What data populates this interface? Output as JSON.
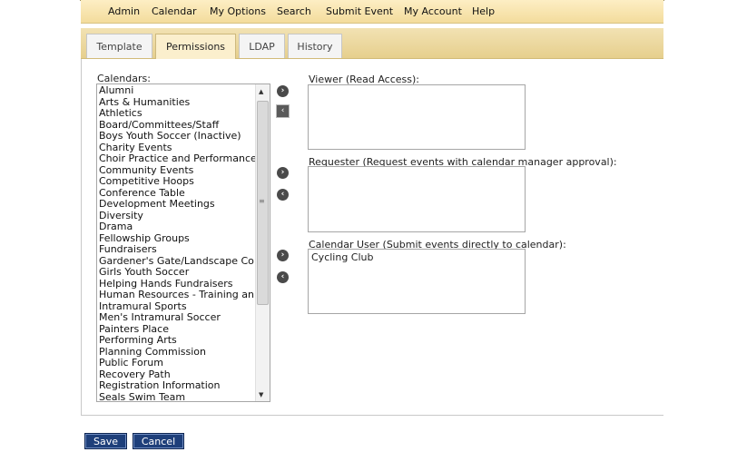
{
  "menu": [
    "Admin",
    "Calendar",
    "My Options",
    "Search",
    "Submit Event",
    "My Account",
    "Help"
  ],
  "tabs": [
    {
      "label": "Template",
      "active": false
    },
    {
      "label": "Permissions",
      "active": true
    },
    {
      "label": "LDAP",
      "active": false
    },
    {
      "label": "History",
      "active": false
    }
  ],
  "calendars": {
    "label": "Calendars:",
    "items": [
      "Alumni",
      "Arts & Humanities",
      "Athletics",
      "Board/Committees/Staff",
      "Boys Youth Soccer (Inactive)",
      "Charity Events",
      "Choir Practice and Performance",
      "Community Events",
      "Competitive Hoops",
      "Conference Table",
      "Development Meetings",
      "Diversity",
      "Drama",
      "Fellowship Groups",
      "Fundraisers",
      "Gardener's Gate/Landscape Co",
      "Girls Youth Soccer",
      "Helping Hands Fundraisers",
      "Human Resources - Training an",
      "Intramural Sports",
      "Men's Intramural Soccer",
      "Painters Place",
      "Performing Arts",
      "Planning Commission",
      "Public Forum",
      "Recovery Path",
      "Registration Information",
      "Seals Swim Team"
    ]
  },
  "viewer": {
    "label": "Viewer (Read Access):",
    "items": []
  },
  "requester": {
    "label": "Requester (Request events with calendar manager approval):",
    "items": []
  },
  "calendar_user": {
    "label": "Calendar User (Submit events directly to calendar):",
    "items": [
      "Cycling Club"
    ]
  },
  "buttons": {
    "save": "Save",
    "cancel": "Cancel"
  },
  "colors": {
    "accent": "#1e3f7a",
    "menu_bg": "#f3dc9c",
    "tab_bg": "#e6cf8d"
  }
}
